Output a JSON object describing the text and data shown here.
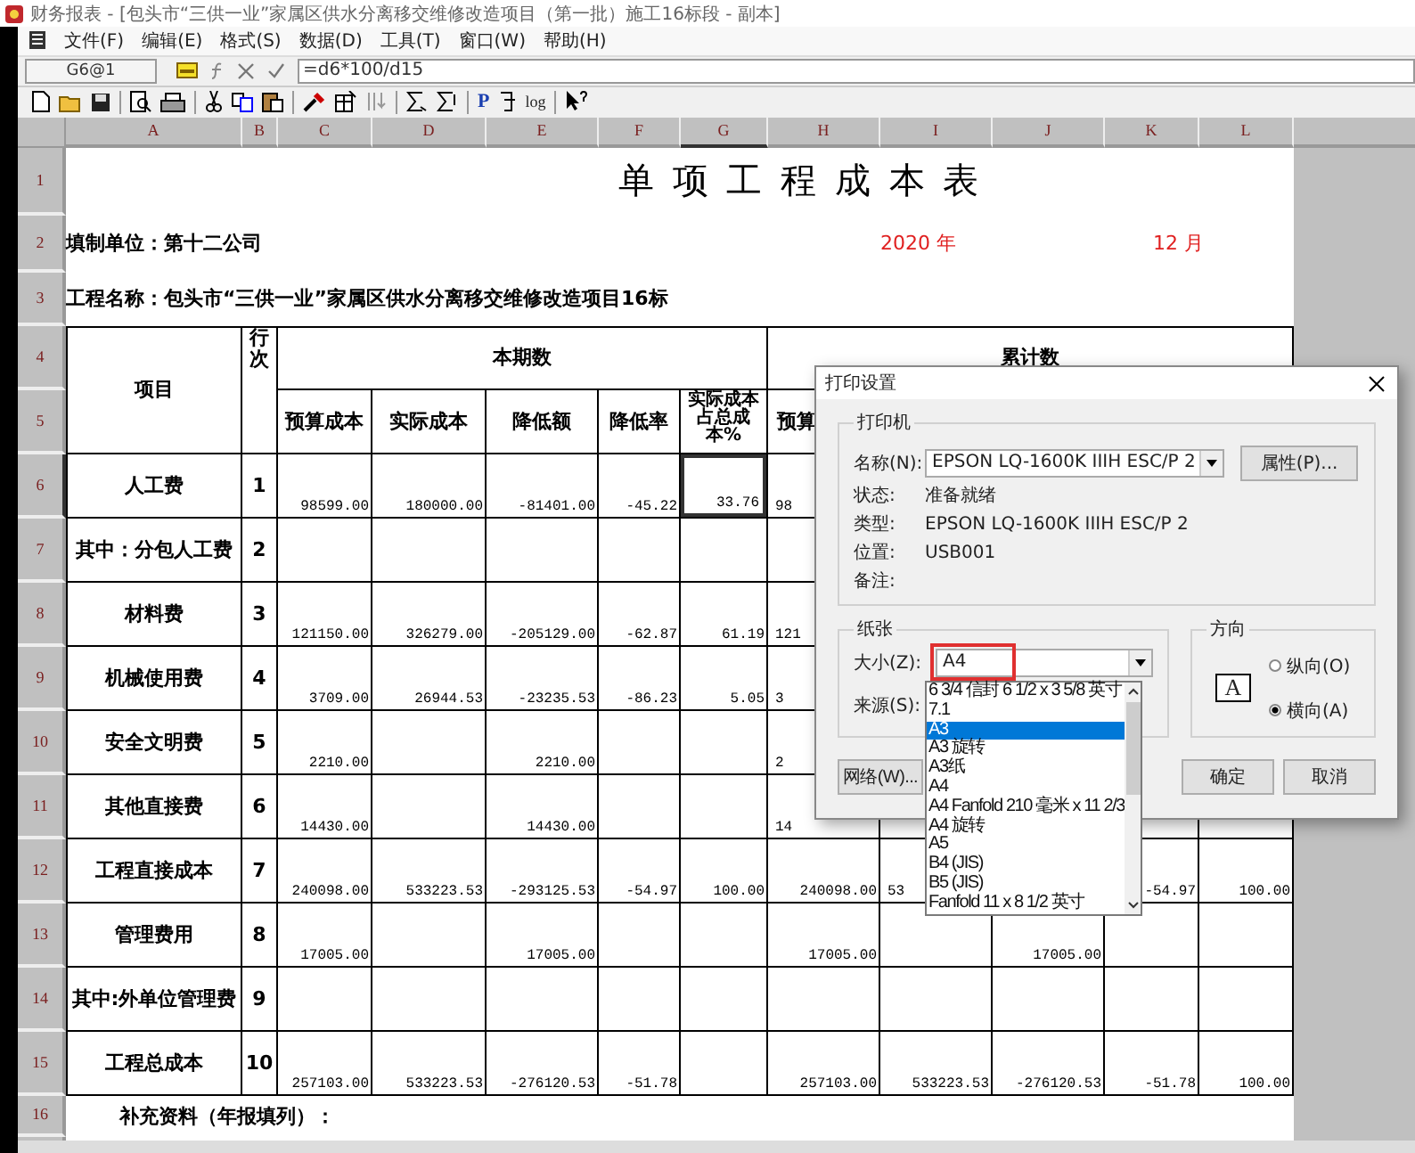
{
  "title_bar": {
    "title": "财务报表 - [包头市“三供一业”家属区供水分离移交维修改造项目（第一批）施工16标段 - 副本]"
  },
  "menu": [
    "文件(F)",
    "编辑(E)",
    "格式(S)",
    "数据(D)",
    "工具(T)",
    "窗口(W)",
    "帮助(H)"
  ],
  "formula_bar": {
    "cell": "G6@1",
    "formula": "=d6*100/d15"
  },
  "toolbar_text": [
    "P",
    "log"
  ],
  "columns": [
    {
      "label": "A",
      "selected": false
    },
    {
      "label": "B",
      "selected": false
    },
    {
      "label": "C",
      "selected": false
    },
    {
      "label": "D",
      "selected": false
    },
    {
      "label": "E",
      "selected": false
    },
    {
      "label": "F",
      "selected": false
    },
    {
      "label": "G",
      "selected": true
    },
    {
      "label": "H",
      "selected": false
    },
    {
      "label": "I",
      "selected": false
    },
    {
      "label": "J",
      "selected": false
    },
    {
      "label": "K",
      "selected": false
    },
    {
      "label": "L",
      "selected": false
    }
  ],
  "row_numbers": [
    "1",
    "2",
    "3",
    "4",
    "5",
    "6",
    "7",
    "8",
    "9",
    "10",
    "11",
    "12",
    "13",
    "14",
    "15",
    "16"
  ],
  "sheet": {
    "title": "单 项 工 程 成 本 表",
    "unit": "填制单位：第十二公司",
    "year": "2020 年",
    "month": "12 月",
    "project": "工程名称：包头市“三供一业”家属区供水分离移交维修改造项目16标",
    "item_header": "项目",
    "seq_header": "行次",
    "current_header": "本期数",
    "cumulative_header": "累计数",
    "sub_headers": [
      "预算成本",
      "实际成本",
      "降低额",
      "降低率",
      "实际成本占总成本%"
    ],
    "cumulative_sub_header": "预算",
    "note": "补充资料（年报填列）："
  },
  "rows": [
    {
      "item": "人工费",
      "no": "1",
      "selected": true,
      "values": {
        "C": "98599.00",
        "D": "180000.00",
        "E": "-81401.00",
        "F": "-45.22",
        "G": "33.76",
        "H": {
          "text": "98",
          "cut": true
        }
      }
    },
    {
      "item": "其中：分包人工费",
      "no": "2",
      "selected": false
    },
    {
      "item": "材料费",
      "no": "3",
      "selected": false,
      "values": {
        "C": "121150.00",
        "D": "326279.00",
        "E": "-205129.00",
        "F": "-62.87",
        "G": "61.19",
        "H": {
          "text": "121",
          "cut": true
        }
      }
    },
    {
      "item": "机械使用费",
      "no": "4",
      "selected": false,
      "values": {
        "C": "3709.00",
        "D": "26944.53",
        "E": "-23235.53",
        "F": "-86.23",
        "G": "5.05",
        "H": {
          "text": "3",
          "cut": true
        }
      }
    },
    {
      "item": "安全文明费",
      "no": "5",
      "selected": false,
      "values": {
        "C": "2210.00",
        "E": "2210.00",
        "H": {
          "text": "2",
          "cut": true
        }
      }
    },
    {
      "item": "其他直接费",
      "no": "6",
      "selected": false,
      "values": {
        "C": "14430.00",
        "E": "14430.00",
        "H": {
          "text": "14",
          "cut": true
        }
      }
    },
    {
      "item": "工程直接成本",
      "no": "7",
      "selected": false,
      "values": {
        "C": "240098.00",
        "D": "533223.53",
        "E": "-293125.53",
        "F": "-54.97",
        "G": "100.00",
        "H": "240098.00",
        "I": {
          "text": "53",
          "cut": true
        },
        "K": "-54.97",
        "L": "100.00"
      }
    },
    {
      "item": "管理费用",
      "no": "8",
      "selected": false,
      "values": {
        "C": "17005.00",
        "E": "17005.00",
        "H": "17005.00",
        "J": "17005.00"
      }
    },
    {
      "item": "其中:外单位管理费",
      "no": "9",
      "selected": false
    },
    {
      "item": "工程总成本",
      "no": "10",
      "selected": false,
      "values": {
        "C": "257103.00",
        "D": "533223.53",
        "E": "-276120.53",
        "F": "-51.78",
        "H": "257103.00",
        "I": "533223.53",
        "J": "-276120.53",
        "K": "-51.78",
        "L": "100.00"
      }
    }
  ],
  "print_dialog": {
    "title": "打印设置",
    "printer_group": "打印机",
    "name_label": "名称(N):",
    "printer": "EPSON LQ-1600K IIIH ESC/P 2",
    "properties_button": "属性(P)...",
    "info": [
      {
        "label": "状态:",
        "value": "准备就绪"
      },
      {
        "label": "类型:",
        "value": "EPSON LQ-1600K IIIH ESC/P 2"
      },
      {
        "label": "位置:",
        "value": "USB001"
      },
      {
        "label": "备注:"
      }
    ],
    "paper_group": "纸张",
    "size_label": "大小(Z):",
    "size": "A4",
    "size_highlighted": true,
    "source_label": "来源(S):",
    "size_options": [
      {
        "label": "6 3/4 信封 6 1/2 x 3 5/8 英寸",
        "selected": false
      },
      {
        "label": "7.1",
        "selected": false
      },
      {
        "label": "A3",
        "selected": true
      },
      {
        "label": "A3 旋转",
        "selected": false
      },
      {
        "label": "A3纸",
        "selected": false
      },
      {
        "label": "A4",
        "selected": false
      },
      {
        "label": "A4 Fanfold 210 毫米 x 11 2/3",
        "selected": false
      },
      {
        "label": "A4 旋转",
        "selected": false
      },
      {
        "label": "A5",
        "selected": false
      },
      {
        "label": "B4 (JIS)",
        "selected": false
      },
      {
        "label": "B5 (JIS)",
        "selected": false
      },
      {
        "label": "Fanfold 11 x 8 1/2 英寸",
        "selected": false
      }
    ],
    "orientation_group": "方向",
    "orientation_preview": "A",
    "orientations": [
      {
        "label": "纵向(O)",
        "selected": false
      },
      {
        "label": "横向(A)",
        "selected": true
      }
    ],
    "buttons": [
      {
        "label": "网络(W)...",
        "kind": "network"
      },
      {
        "label": "确定",
        "kind": "ok"
      },
      {
        "label": "取消",
        "kind": "cancel"
      }
    ]
  }
}
